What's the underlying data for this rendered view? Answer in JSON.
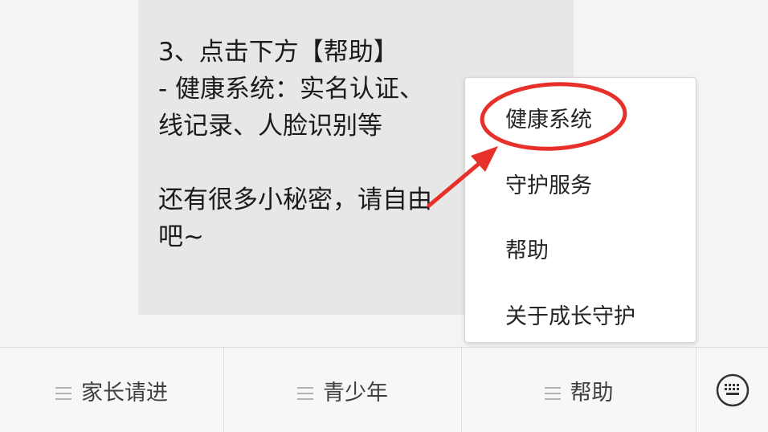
{
  "message": {
    "lines": [
      "3、点击下方【帮助】",
      "- 健康系统：实名认证、",
      "线记录、人脸识别等",
      "还有很多小秘密，请自由",
      "吧~"
    ]
  },
  "popup_menu": {
    "items": [
      "健康系统",
      "守护服务",
      "帮助",
      "关于成长守护"
    ]
  },
  "tabbar": {
    "tabs": [
      "家长请进",
      "青少年",
      "帮助"
    ]
  },
  "icons": {
    "menu": "menu-lines-icon",
    "keyboard": "keyboard-icon"
  },
  "colors": {
    "highlight": "#e8302a"
  }
}
